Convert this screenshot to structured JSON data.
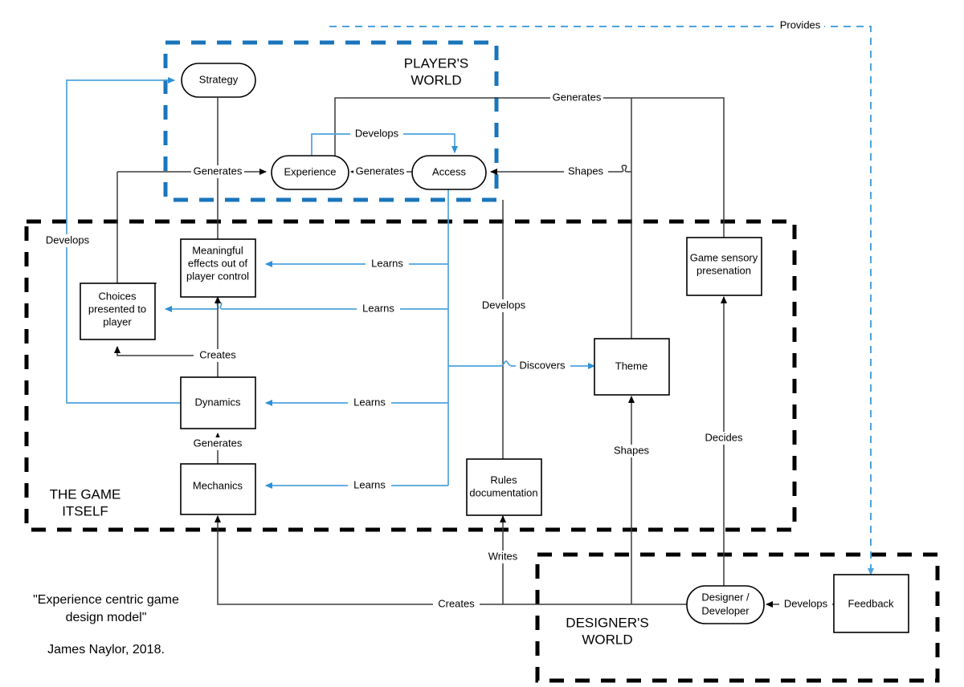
{
  "diagram": {
    "title": "Experience centric game design model",
    "caption_line_1": "\"Experience centric game",
    "caption_line_2": "design model\"",
    "caption_author": "James Naylor, 2018.",
    "colors": {
      "blue_accent": "#1a75bb",
      "blue_edge": "#4da2dd",
      "black_edge": "#3b3b3b",
      "zone_black": "#000000",
      "background": "#ffffff"
    }
  },
  "zones": [
    {
      "id": "players-world",
      "label_line_1": "PLAYER'S",
      "label_line_2": "WORLD",
      "style": "dashed-blue"
    },
    {
      "id": "the-game-itself",
      "label_line_1": "THE GAME",
      "label_line_2": "ITSELF",
      "style": "dashed-black"
    },
    {
      "id": "designers-world",
      "label_line_1": "DESIGNER'S",
      "label_line_2": "WORLD",
      "style": "dashed-black"
    }
  ],
  "nodes": [
    {
      "id": "strategy",
      "label": "Strategy",
      "shape": "rounded",
      "zone": "players-world"
    },
    {
      "id": "experience",
      "label": "Experience",
      "shape": "rounded",
      "zone": "players-world"
    },
    {
      "id": "access",
      "label": "Access",
      "shape": "rounded",
      "zone": "players-world"
    },
    {
      "id": "meaningful-effects",
      "label_line_1": "Meaningful",
      "label_line_2": "effects out of",
      "label_line_3": "player control",
      "shape": "rect",
      "zone": "the-game-itself"
    },
    {
      "id": "choices-presented",
      "label_line_1": "Choices",
      "label_line_2": "presented to",
      "label_line_3": "player",
      "shape": "rect",
      "zone": "the-game-itself"
    },
    {
      "id": "dynamics",
      "label": "Dynamics",
      "shape": "rect",
      "zone": "the-game-itself"
    },
    {
      "id": "mechanics",
      "label": "Mechanics",
      "shape": "rect",
      "zone": "the-game-itself"
    },
    {
      "id": "rules-documentation",
      "label_line_1": "Rules",
      "label_line_2": "documentation",
      "shape": "rect",
      "zone": "the-game-itself"
    },
    {
      "id": "theme",
      "label": "Theme",
      "shape": "rect",
      "zone": "the-game-itself"
    },
    {
      "id": "game-sensory-presentation",
      "label_line_1": "Game sensory",
      "label_line_2": "presenation",
      "shape": "rect",
      "zone": "the-game-itself"
    },
    {
      "id": "designer-developer",
      "label_line_1": "Designer /",
      "label_line_2": "Developer",
      "shape": "rounded",
      "zone": "designers-world"
    },
    {
      "id": "feedback",
      "label": "Feedback",
      "shape": "rect",
      "zone": "designers-world"
    }
  ],
  "edges": [
    {
      "id": "provides",
      "label": "Provides",
      "from": "access",
      "to": "feedback",
      "color": "blue",
      "style": "dashed"
    },
    {
      "id": "develops-experience-access",
      "label": "Develops",
      "from": "experience",
      "to": "access",
      "color": "blue"
    },
    {
      "id": "generates-access-experience",
      "label": "Generates",
      "from": "access",
      "to": "experience",
      "color": "black"
    },
    {
      "id": "generates-strategy-experience",
      "label": "Generates",
      "from": "strategy",
      "to": "experience",
      "color": "black"
    },
    {
      "id": "generates-gamesensory-experience",
      "label": "Generates",
      "from": "game-sensory-presentation",
      "to": "experience",
      "color": "black"
    },
    {
      "id": "shapes-theme-access",
      "label": "Shapes",
      "from": "theme",
      "to": "access",
      "color": "black"
    },
    {
      "id": "develops-dynamics-strategy",
      "label": "Develops",
      "from": "dynamics",
      "to": "strategy",
      "color": "blue"
    },
    {
      "id": "develops-access-rules",
      "label": "Develops",
      "from": "access",
      "to": "rules-documentation",
      "color": "black"
    },
    {
      "id": "learns-meaningful",
      "label": "Learns",
      "from": "access",
      "to": "meaningful-effects",
      "color": "blue"
    },
    {
      "id": "learns-choices",
      "label": "Learns",
      "from": "access",
      "to": "choices-presented",
      "color": "blue"
    },
    {
      "id": "learns-dynamics",
      "label": "Learns",
      "from": "access",
      "to": "dynamics",
      "color": "blue"
    },
    {
      "id": "learns-mechanics",
      "label": "Learns",
      "from": "access",
      "to": "mechanics",
      "color": "blue"
    },
    {
      "id": "discovers-theme",
      "label": "Discovers",
      "from": "access",
      "to": "theme",
      "color": "blue"
    },
    {
      "id": "creates-dynamics-choices",
      "label": "Creates",
      "from": "dynamics",
      "to": "choices-presented",
      "color": "black"
    },
    {
      "id": "generates-mechanics-dynamics",
      "label": "Generates",
      "from": "mechanics",
      "to": "dynamics",
      "color": "black"
    },
    {
      "id": "creates-designer-mechanics",
      "label": "Creates",
      "from": "designer-developer",
      "to": "mechanics",
      "color": "black"
    },
    {
      "id": "writes-designer-rules",
      "label": "Writes",
      "from": "designer-developer",
      "to": "rules-documentation",
      "color": "black"
    },
    {
      "id": "shapes-designer-theme",
      "label": "Shapes",
      "from": "designer-developer",
      "to": "theme",
      "color": "black"
    },
    {
      "id": "decides-designer-gamesensory",
      "label": "Decides",
      "from": "designer-developer",
      "to": "game-sensory-presentation",
      "color": "black"
    },
    {
      "id": "develops-feedback-designer",
      "label": "Develops",
      "from": "feedback",
      "to": "designer-developer",
      "color": "black"
    }
  ]
}
